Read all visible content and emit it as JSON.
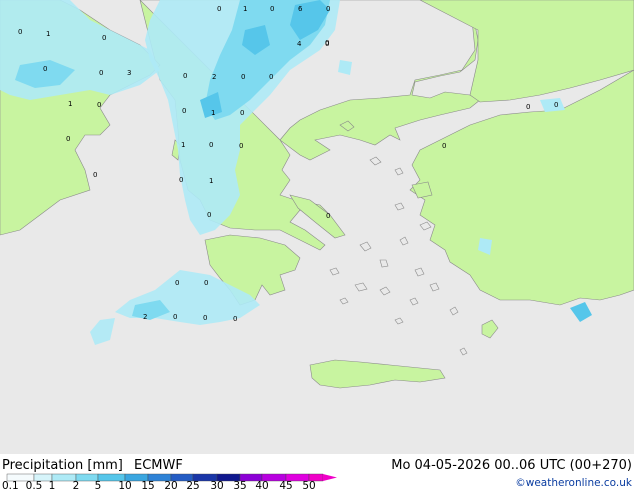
{
  "map_title": "Precipitation [mm]",
  "model": "ECMWF",
  "valid_time": "Mo 04-05-2026 00..06 UTC (00+270)",
  "credit": "©weatheronline.co.uk",
  "legend": {
    "ticks": [
      "0.1",
      "0.5",
      "1",
      "2",
      "5",
      "10",
      "15",
      "20",
      "25",
      "30",
      "35",
      "40",
      "45",
      "50"
    ],
    "colors": [
      "#f5fbfd",
      "#d6f4fa",
      "#aeeaf6",
      "#7fdaf0",
      "#56c6ea",
      "#3aa6e0",
      "#2e82d6",
      "#245cc4",
      "#1a36a8",
      "#10188e",
      "#8c00d6",
      "#b800e0",
      "#e000e0",
      "#f000c8"
    ]
  },
  "precip_values": [
    "0",
    "1",
    "0",
    "6",
    "0",
    "0",
    "1",
    "0",
    "4",
    "0",
    "0",
    "0",
    "3",
    "0",
    "2",
    "0",
    "0",
    "0",
    "1",
    "0",
    "0",
    "1",
    "0",
    "0",
    "0",
    "0",
    "1",
    "0",
    "0",
    "1",
    "0",
    "0",
    "0",
    "0",
    "0",
    "0",
    "2",
    "0",
    "0",
    "0",
    "0"
  ],
  "colors": {
    "sea": "#e9e9e9",
    "land": "#c8f4a0",
    "precip_light": "#aeeaf6",
    "precip_medium": "#7fdaf0",
    "precip_heavy": "#56c6ea",
    "coast": "#888888"
  }
}
